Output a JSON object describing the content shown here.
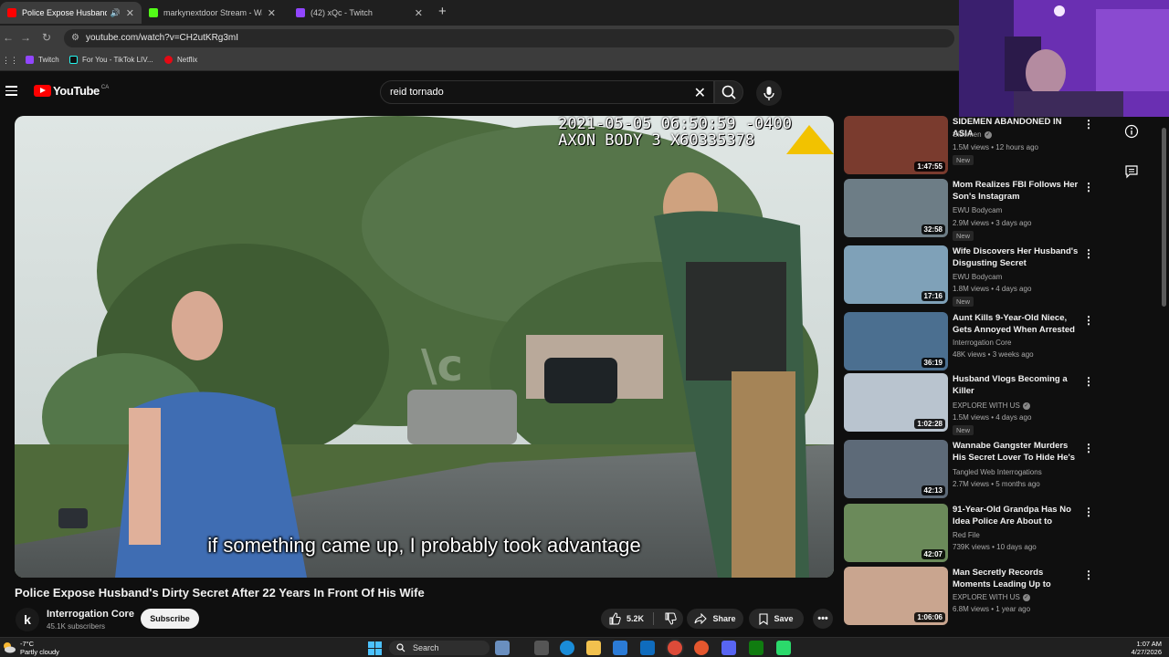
{
  "browser": {
    "tabs": [
      {
        "title": "Police Expose Husband's Di",
        "color": "#ff0000",
        "active": true
      },
      {
        "title": "markynextdoor Stream - Watch",
        "color": "#53fc18",
        "active": false
      },
      {
        "title": "(42) xQc - Twitch",
        "color": "#9146ff",
        "active": false
      }
    ],
    "url": "youtube.com/watch?v=CH2utKRg3mI",
    "bookmarks": [
      {
        "label": "Twitch",
        "color": "#9146ff"
      },
      {
        "label": "For You - TikTok LIV...",
        "color": "#000000"
      },
      {
        "label": "Netflix",
        "color": "#e50914"
      }
    ]
  },
  "youtube": {
    "logo_text": "YouTube",
    "region": "CA",
    "search_query": "reid tornado"
  },
  "video": {
    "timestamp_line": "2021-05-05 06:50:59 -0400",
    "device_line": "AXON BODY 3 X60335378",
    "subtitle": "if something came up, I probably took advantage",
    "title": "Police Expose Husband's Dirty Secret After 22 Years In Front Of His Wife",
    "channel": "Interrogation Core",
    "subscribers": "45.1K subscribers",
    "subscribe_label": "Subscribe",
    "likes": "5.2K",
    "share_label": "Share",
    "save_label": "Save"
  },
  "recommendations": [
    {
      "title": "SIDEMEN ABANDONED IN ASIA",
      "channel": "Sidemen",
      "verified": true,
      "meta": "1.5M views • 12 hours ago",
      "badge": "New",
      "duration": "1:47:55",
      "thumb": "#7a3b2e"
    },
    {
      "title": "Mom Realizes FBI Follows Her Son's Instagram",
      "channel": "EWU Bodycam",
      "verified": false,
      "meta": "2.9M views • 3 days ago",
      "badge": "New",
      "duration": "32:58",
      "thumb": "#6d7d86"
    },
    {
      "title": "Wife Discovers Her Husband's Disgusting Secret",
      "channel": "EWU Bodycam",
      "verified": false,
      "meta": "1.8M views • 4 days ago",
      "badge": "New",
      "duration": "17:16",
      "thumb": "#7fa1b8"
    },
    {
      "title": "Aunt Kills 9-Year-Old Niece, Gets Annoyed When Arrested",
      "channel": "Interrogation Core",
      "verified": false,
      "meta": "48K views • 3 weeks ago",
      "badge": "",
      "duration": "36:19",
      "thumb": "#4b6f90"
    },
    {
      "title": "Husband Vlogs Becoming a Killer",
      "channel": "EXPLORE WITH US",
      "verified": true,
      "meta": "1.5M views • 4 days ago",
      "badge": "New",
      "duration": "1:02:28",
      "thumb": "#b9c4cf"
    },
    {
      "title": "Wannabe Gangster Murders His Secret Lover To Hide He's Gay",
      "channel": "Tangled Web Interrogations",
      "verified": false,
      "meta": "2.7M views • 5 months ago",
      "badge": "",
      "duration": "42:13",
      "thumb": "#5d6a78"
    },
    {
      "title": "91-Year-Old Grandpa Has No Idea Police Are About to Arres...",
      "channel": "Red File",
      "verified": false,
      "meta": "739K views • 10 days ago",
      "badge": "",
      "duration": "42:07",
      "thumb": "#6b8a5a"
    },
    {
      "title": "Man Secretly Records Moments Leading Up to Killing",
      "channel": "EXPLORE WITH US",
      "verified": true,
      "meta": "6.8M views • 1 year ago",
      "badge": "",
      "duration": "1:06:06",
      "thumb": "#c9a58f"
    }
  ],
  "taskbar": {
    "weather_temp": "-7°C",
    "weather_desc": "Partly cloudy",
    "search_label": "Search",
    "time": "1:07 AM",
    "date": "4/27/2026"
  }
}
